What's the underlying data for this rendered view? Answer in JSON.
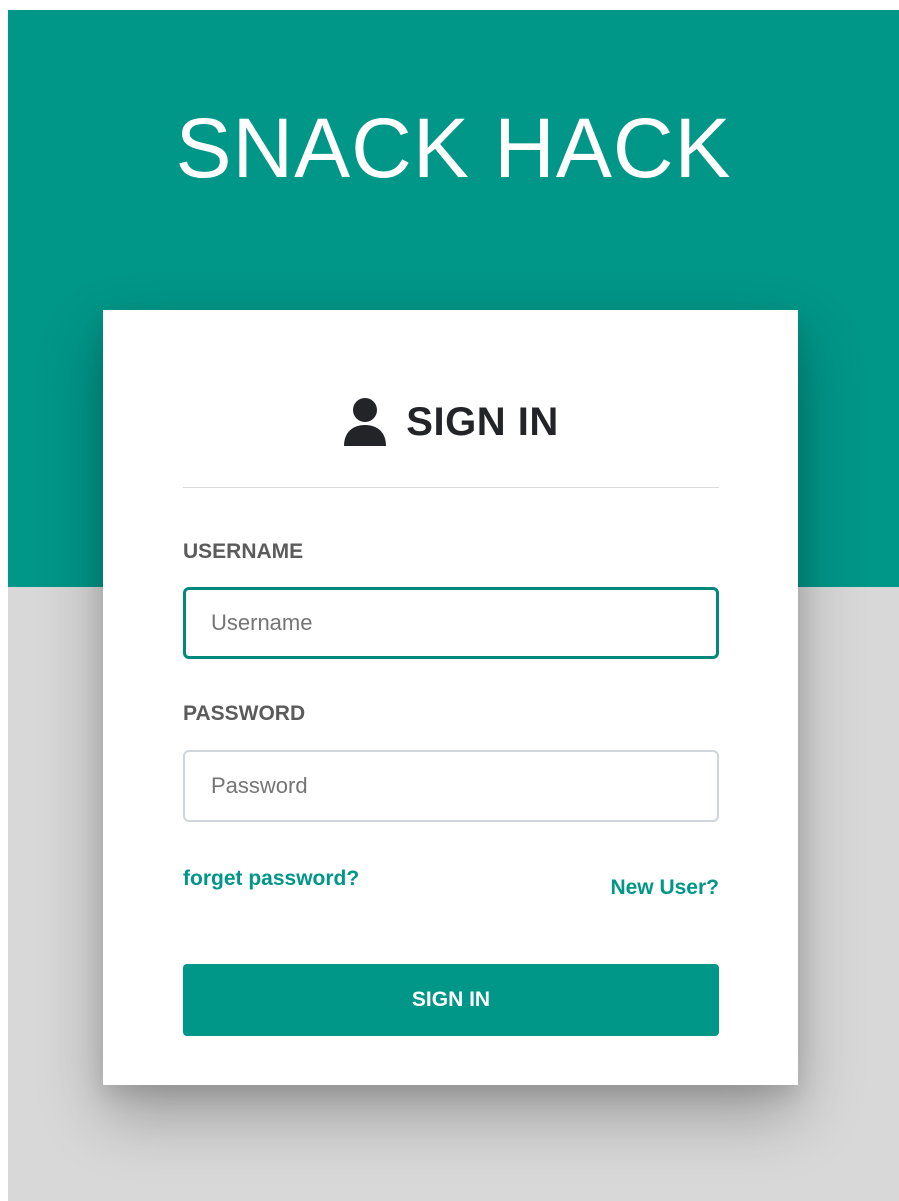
{
  "app": {
    "brand_title": "SNACK HACK"
  },
  "login_card": {
    "heading": "SIGN IN",
    "heading_icon": "user-icon",
    "username": {
      "label": "USERNAME",
      "placeholder": "Username",
      "value": ""
    },
    "password": {
      "label": "PASSWORD",
      "placeholder": "Password",
      "value": ""
    },
    "forgot_link": "forget password?",
    "new_user_link": "New User?",
    "submit_label": "SIGN IN"
  },
  "colors": {
    "brand_teal": "#009688",
    "background_gray": "#d8d8d8",
    "heading_text": "#222428",
    "link_text": "#00968a"
  }
}
